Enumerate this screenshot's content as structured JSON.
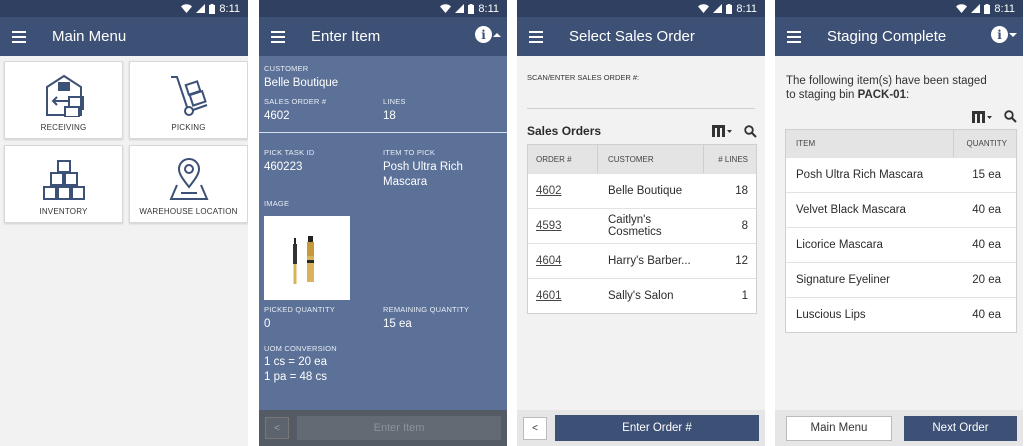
{
  "status": {
    "time": "8:11"
  },
  "screen1": {
    "title": "Main Menu",
    "tiles": [
      {
        "label": "RECEIVING",
        "icon": "receiving-icon"
      },
      {
        "label": "PICKING",
        "icon": "hand-truck-icon"
      },
      {
        "label": "INVENTORY",
        "icon": "boxes-stack-icon"
      },
      {
        "label": "WAREHOUSE LOCATION",
        "icon": "map-pin-icon"
      }
    ]
  },
  "screen2": {
    "title": "Enter Item",
    "customer_label": "CUSTOMER",
    "customer": "Belle Boutique",
    "sales_order_label": "SALES ORDER #",
    "sales_order": "4602",
    "lines_label": "LINES",
    "lines": "18",
    "pick_task_label": "PICK TASK ID",
    "pick_task": "460223",
    "item_to_pick_label": "ITEM TO PICK",
    "item_to_pick": "Posh Ultra Rich Mascara",
    "image_label": "IMAGE",
    "picked_qty_label": "PICKED QUANTITY",
    "picked_qty": "0",
    "remaining_qty_label": "REMAINING QUANTITY",
    "remaining_qty": "15 ea",
    "uom_label": "UOM CONVERSION",
    "uom_1": "1 cs = 20 ea",
    "uom_2": "1 pa = 48 cs",
    "back_label": "<",
    "enter_label": "Enter Item"
  },
  "screen3": {
    "title": "Select Sales Order",
    "scan_label": "SCAN/ENTER SALES ORDER #:",
    "section_title": "Sales Orders",
    "columns": [
      "ORDER #",
      "CUSTOMER",
      "# LINES"
    ],
    "rows": [
      {
        "order": "4602",
        "customer": "Belle Boutique",
        "lines": "18"
      },
      {
        "order": "4593",
        "customer": "Caitlyn's Cosmetics",
        "lines": "8"
      },
      {
        "order": "4604",
        "customer": "Harry's Barber...",
        "lines": "12"
      },
      {
        "order": "4601",
        "customer": "Sally's Salon",
        "lines": "1"
      }
    ],
    "back_label": "<",
    "enter_label": "Enter Order #"
  },
  "screen4": {
    "title": "Staging Complete",
    "message_1": "The following item(s) have been staged",
    "message_2": "to staging bin",
    "bin": "PACK-01",
    "message_end": ":",
    "columns": [
      "ITEM",
      "QUANTITY"
    ],
    "rows": [
      {
        "item": "Posh Ultra Rich Mascara",
        "qty": "15 ea"
      },
      {
        "item": "Velvet Black Mascara",
        "qty": "40 ea"
      },
      {
        "item": "Licorice Mascara",
        "qty": "40 ea"
      },
      {
        "item": "Signature Eyeliner",
        "qty": "20 ea"
      },
      {
        "item": "Luscious Lips",
        "qty": "40 ea"
      }
    ],
    "main_menu_label": "Main Menu",
    "next_order_label": "Next Order"
  },
  "colors": {
    "header": "#3d5075",
    "statusbar": "#2f4060",
    "item_panel": "#5b7197"
  }
}
